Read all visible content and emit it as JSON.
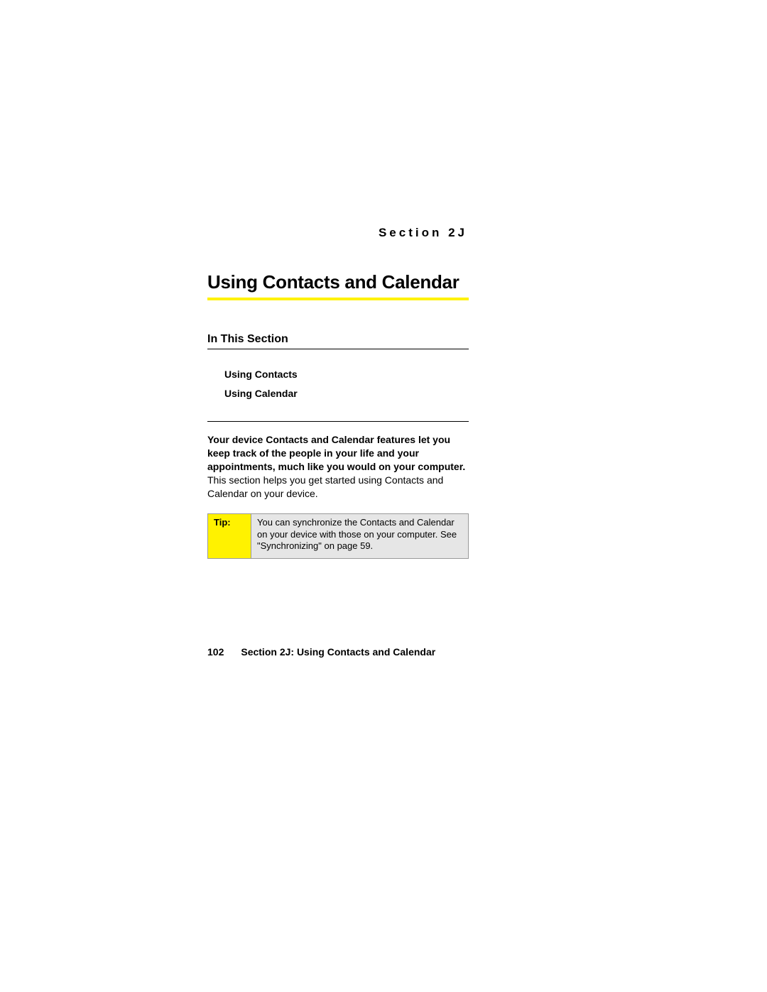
{
  "section_label": "Section 2J",
  "title": "Using Contacts and Calendar",
  "subheading": "In This Section",
  "toc": [
    "Using Contacts",
    "Using Calendar"
  ],
  "body": {
    "bold": "Your device Contacts and Calendar features let you keep track of the people in your life and your appointments, much like you would on your computer.",
    "rest": " This section helps you get started using Contacts and Calendar on your device."
  },
  "tip": {
    "label": "Tip:",
    "text": "You can synchronize the Contacts and Calendar on your device with those on your computer. See \"Synchronizing\" on page 59."
  },
  "footer": {
    "page_number": "102",
    "text": "Section 2J: Using Contacts and Calendar"
  }
}
